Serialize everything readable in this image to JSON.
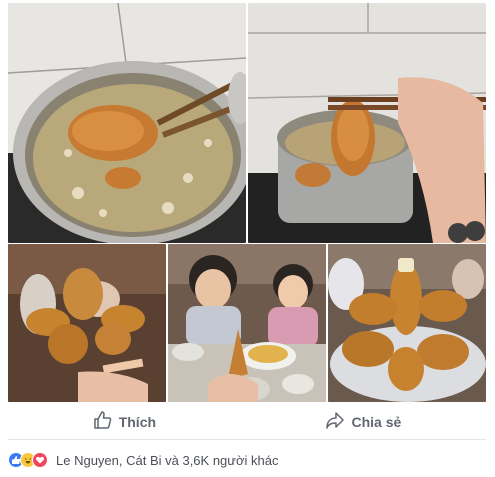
{
  "actions": {
    "like_label": "Thích",
    "share_label": "Chia sẻ"
  },
  "reactions": {
    "summary": "Le Nguyen, Cát Bi và 3,6K người khác",
    "icons": [
      "like-icon",
      "haha-icon",
      "love-icon"
    ]
  },
  "colors": {
    "like_blue": "#3b79f5",
    "haha_yellow": "#f7c93a",
    "love_red": "#f0475c",
    "action_text": "#616770"
  }
}
